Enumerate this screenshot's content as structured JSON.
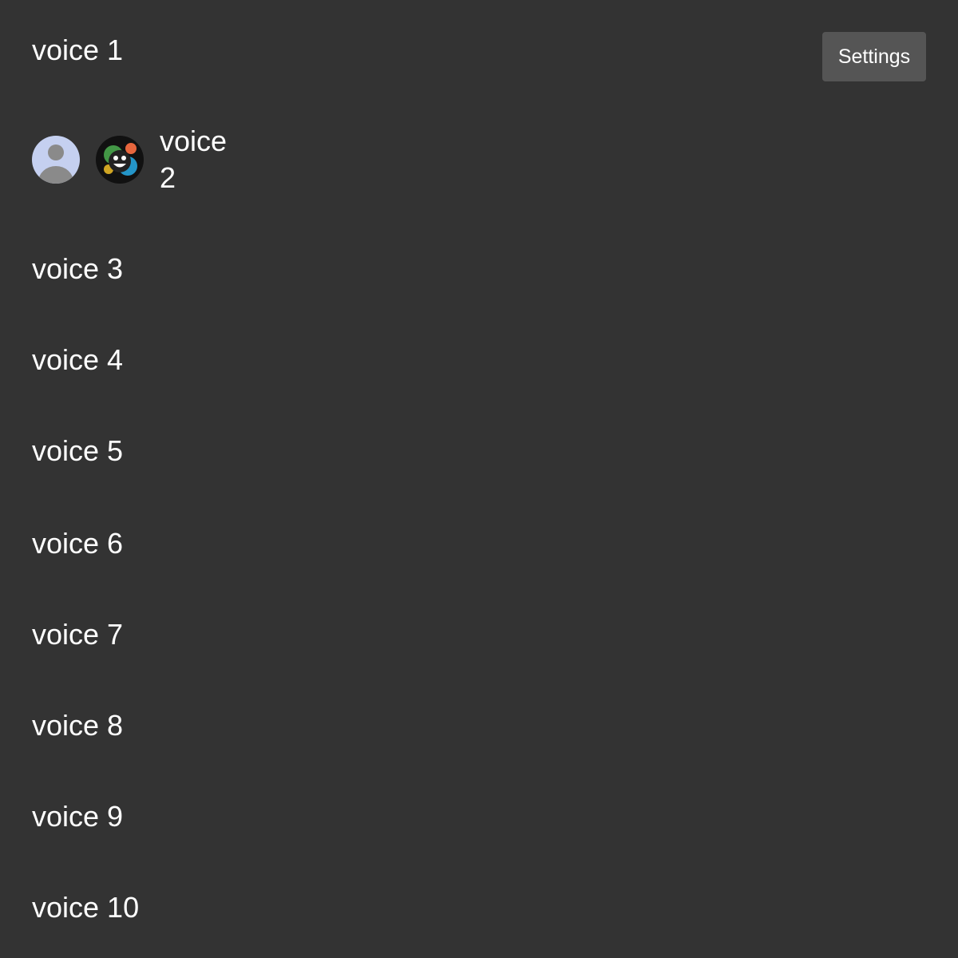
{
  "header": {
    "settings_label": "Settings"
  },
  "channels": [
    {
      "label": "voice 1"
    },
    {
      "label": "voice 2",
      "members": [
        {
          "name": "default-avatar-icon"
        },
        {
          "name": "emoji-avatar-icon"
        }
      ]
    },
    {
      "label": "voice 3"
    },
    {
      "label": "voice 4"
    },
    {
      "label": "voice 5"
    },
    {
      "label": "voice 6"
    },
    {
      "label": "voice 7"
    },
    {
      "label": "voice 8"
    },
    {
      "label": "voice 9"
    },
    {
      "label": "voice 10"
    }
  ],
  "colors": {
    "background": "#333333",
    "button_bg": "#555555",
    "text": "#ffffff",
    "default_avatar_bg": "#c5d0f0",
    "default_avatar_fg": "#8a8a8a"
  }
}
